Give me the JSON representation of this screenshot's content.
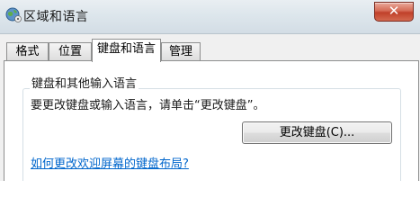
{
  "window": {
    "title": "区域和语言",
    "close_label": "✕"
  },
  "tabs": [
    {
      "label": "格式",
      "active": false
    },
    {
      "label": "位置",
      "active": false
    },
    {
      "label": "键盘和语言",
      "active": true
    },
    {
      "label": "管理",
      "active": false
    }
  ],
  "panel": {
    "group_label": "键盘和其他输入语言",
    "instruction": "要更改键盘或输入语言，请单击“更改键盘”。",
    "change_button_label": "更改键盘(C)...",
    "help_link": "如何更改欢迎屏幕的键盘布局?"
  },
  "colors": {
    "link": "#0066cc",
    "close_button": "#c0402a",
    "panel_border": "#8e8f8f"
  }
}
